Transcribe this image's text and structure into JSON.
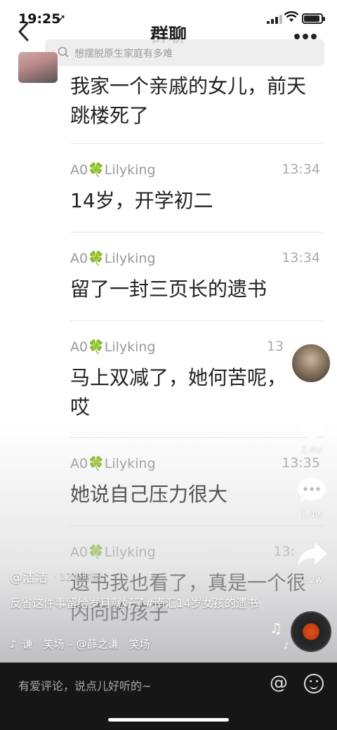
{
  "status_bar": {
    "time": "19:25",
    "location_arrow": "➚"
  },
  "chat": {
    "title": "群聊",
    "search_placeholder": "想摆脱原生家庭有多难",
    "first_message": "我家一个亲戚的女儿，前天跳楼死了",
    "messages": [
      {
        "name": "A0🍀Lilyking",
        "time": "13:34",
        "text": "14岁，开学初二"
      },
      {
        "name": "A0🍀Lilyking",
        "time": "13:34",
        "text": "留了一封三页长的遗书"
      },
      {
        "name": "A0🍀Lilyking",
        "time": "13",
        "text": "马上双减了，她何苦呢，哎"
      },
      {
        "name": "A0🍀Lilyking",
        "time": "13:35",
        "text": "她说自己压力很大"
      },
      {
        "name": "A0🍀Lilyking",
        "time": "13:",
        "text": "遗书我也看了，真是一个很内向的孩子"
      }
    ]
  },
  "video": {
    "author": "@洁洁",
    "post_time": "· 12小时前",
    "caption": "反省这件事留给岁月就好了#南汇14岁女孩的遗书",
    "music": "谦　笑场 – @薛之谦　笑场",
    "likes": "2.4w",
    "comments": "1.4w",
    "shares": "2.2w"
  },
  "bottom": {
    "comment_placeholder": "有爱评论，说点儿好听的~"
  },
  "icons": {
    "back": "chevron-left-icon",
    "more": "more-icon",
    "search": "search-icon",
    "heart": "heart-icon",
    "comment": "comment-icon",
    "share": "share-icon",
    "at": "at-icon",
    "emoji": "emoji-icon"
  }
}
